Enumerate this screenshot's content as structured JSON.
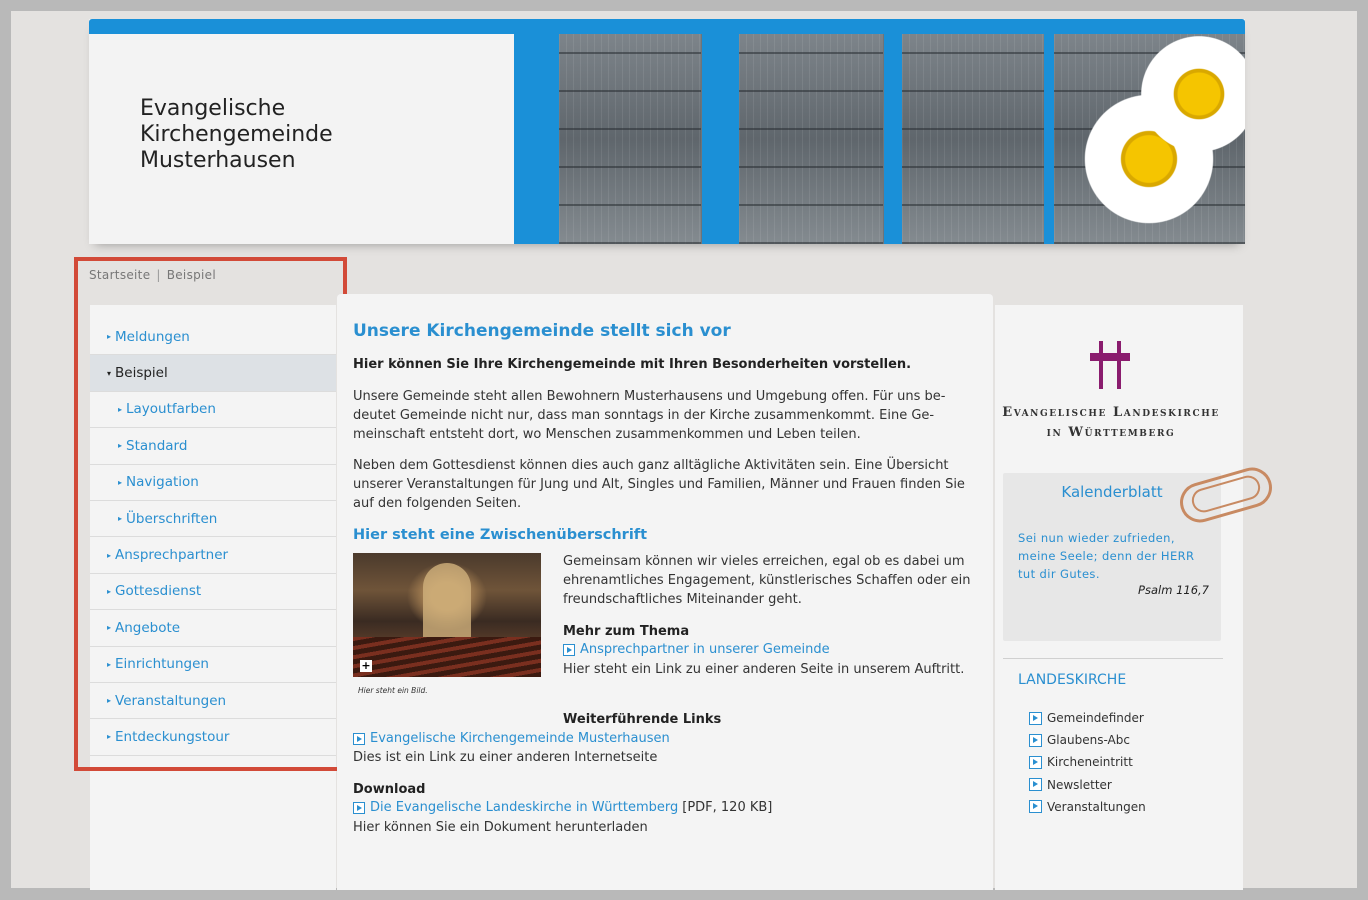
{
  "header": {
    "title": "Evangelische\nKirchengemeinde\nMusterhausen"
  },
  "breadcrumb": {
    "home": "Startseite",
    "separator": "|",
    "current": "Beispiel"
  },
  "sidebar": {
    "items": [
      {
        "label": "Meldungen",
        "level": 1
      },
      {
        "label": "Beispiel",
        "level": 1,
        "active": true
      },
      {
        "label": "Layoutfarben",
        "level": 2
      },
      {
        "label": "Standard",
        "level": 2
      },
      {
        "label": "Navigation",
        "level": 2
      },
      {
        "label": "Überschriften",
        "level": 2
      },
      {
        "label": "Ansprechpartner",
        "level": 1
      },
      {
        "label": "Gottesdienst",
        "level": 1
      },
      {
        "label": "Angebote",
        "level": 1
      },
      {
        "label": "Einrichtungen",
        "level": 1
      },
      {
        "label": "Veranstaltungen",
        "level": 1
      },
      {
        "label": "Entdeckungstour",
        "level": 1
      }
    ]
  },
  "main": {
    "title": "Unsere Kirchengemeinde stellt sich vor",
    "lead": "Hier können Sie Ihre Kirchengemeinde mit Ihren Besonderheiten vorstellen.",
    "para1": "Unsere Gemeinde steht allen Bewohnern Musterhausens und Umgebung offen. Für uns be-deutet Gemeinde nicht nur, dass man sonntags in der Kirche zusammenkommt. Eine Ge-meinschaft entsteht dort, wo Menschen zusammenkommen und Leben teilen.",
    "para2": "Neben dem Gottesdienst können dies auch ganz alltägliche Aktivitäten sein. Eine Übersicht unserer Veranstaltungen für Jung und Alt, Singles und Familien, Männer und Frauen finden Sie auf den folgenden Seiten.",
    "subheading": "Hier steht eine Zwischenüberschrift",
    "image_caption": "Hier steht ein Bild.",
    "image_text": "Gemeinsam können wir vieles erreichen, egal ob es dabei um ehrenamtliches Engagement, künstlerisches Schaffen oder ein freundschaftliches Miteinander geht.",
    "more_title": "Mehr zum Thema",
    "more_link": "Ansprechpartner in unserer Gemeinde",
    "more_text": "Hier steht ein Link zu einer anderen Seite in unserem Auftritt.",
    "links_title": "Weiterführende Links",
    "links_link": "Evangelische Kirchengemeinde Musterhausen",
    "links_text": "Dies ist ein Link zu einer anderen Internetseite",
    "download_title": "Download",
    "download_link": "Die Evangelische Landeskirche in Württemberg",
    "download_meta": "[PDF, 120 KB]",
    "download_text": "Hier können Sie ein Dokument herunterladen"
  },
  "right": {
    "church_name": "Evangelische Landeskirche\nin Württemberg",
    "kalender_title": "Kalenderblatt",
    "kalender_verse": "Sei nun wieder zufrieden, meine Seele; denn der HERR tut dir Gutes.",
    "kalender_ref": "Psalm 116,7",
    "landeskirche_title": "LANDESKIRCHE",
    "landeskirche_links": [
      "Gemeindefinder",
      "Glaubens-Abc",
      "Kircheneintritt",
      "Newsletter",
      "Veranstaltungen"
    ]
  },
  "colors": {
    "accent_blue": "#1a90d8",
    "link_blue": "#2a8fd0",
    "highlight_red": "#d24a38",
    "cross_purple": "#8a1c6e"
  }
}
